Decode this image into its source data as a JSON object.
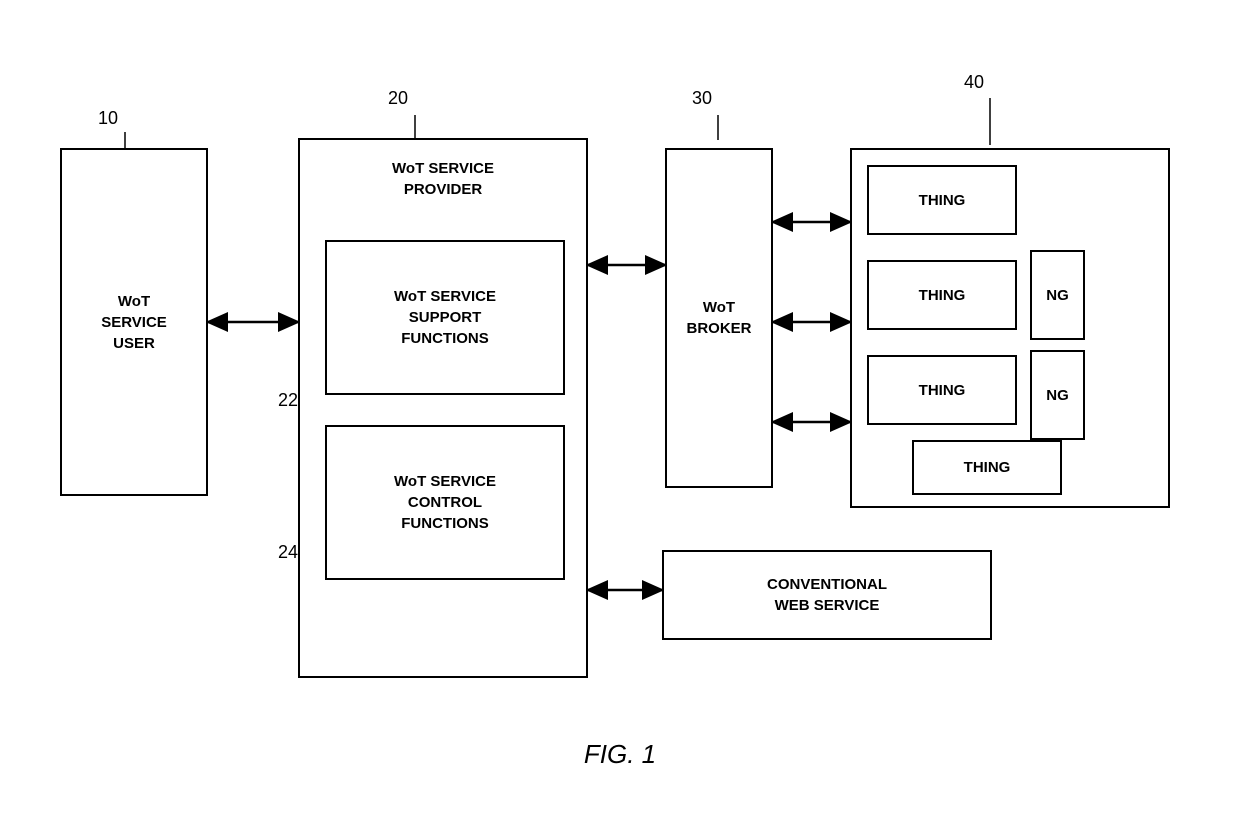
{
  "title": "FIG. 1",
  "ref_numbers": {
    "r10": "10",
    "r20": "20",
    "r30": "30",
    "r40": "40",
    "r22": "22",
    "r24": "24"
  },
  "boxes": {
    "service_user": "WoT\nSERVICE\nUSER",
    "service_provider": "WoT SERVICE\nPROVIDER",
    "support_functions": "WoT SERVICE\nSUPPORT\nFUNCTIONS",
    "control_functions": "WoT SERVICE\nCONTROL\nFUNCTIONS",
    "broker": "WoT\nBROKER",
    "conventional": "CONVENTIONAL\nWEB SERVICE",
    "thing1": "THING",
    "thing2": "THING",
    "thing3": "THING",
    "thing4": "THING",
    "ng1": "NG",
    "ng2": "NG"
  },
  "fig_label": "FIG. 1"
}
